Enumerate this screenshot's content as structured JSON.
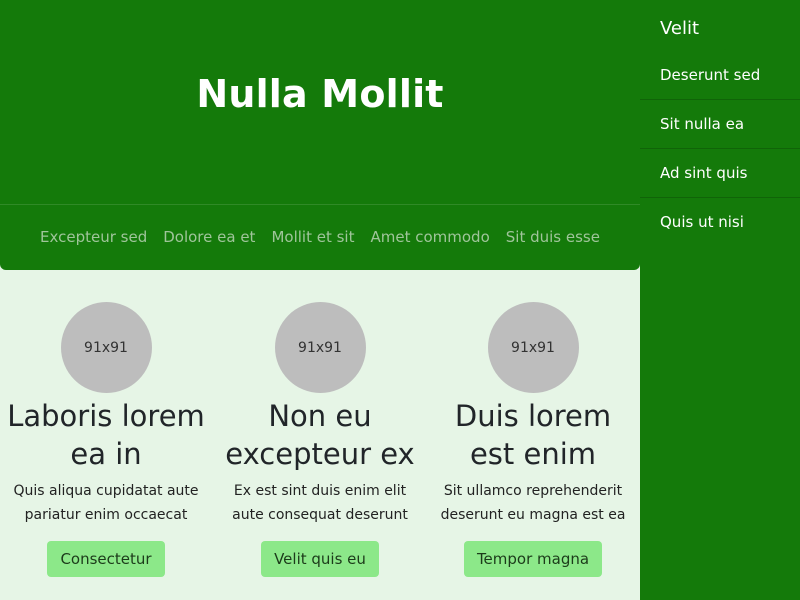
{
  "hero": {
    "title": "Nulla Mollit",
    "nav": [
      "Excepteur sed",
      "Dolore ea et",
      "Mollit et sit",
      "Amet commodo",
      "Sit duis esse"
    ]
  },
  "sidebar": {
    "title": "Velit",
    "items": [
      "Deserunt sed",
      "Sit nulla ea",
      "Ad sint quis",
      "Quis ut nisi"
    ]
  },
  "cards": [
    {
      "image_label": "91x91",
      "title": "Laboris lorem ea in",
      "text": "Quis aliqua cupidatat aute pariatur enim occaecat",
      "button": "Consectetur"
    },
    {
      "image_label": "91x91",
      "title": "Non eu excepteur ex",
      "text": "Ex est sint duis enim elit aute consequat deserunt",
      "button": "Velit quis eu"
    },
    {
      "image_label": "91x91",
      "title": "Duis lorem est enim",
      "text": "Sit ullamco reprehenderit deserunt eu magna est ea",
      "button": "Tempor magna"
    }
  ],
  "colors": {
    "brand_green": "#147a0a",
    "page_bg": "#e6f5e6",
    "button_bg": "#8ce889",
    "placeholder": "#bdbdbd"
  }
}
